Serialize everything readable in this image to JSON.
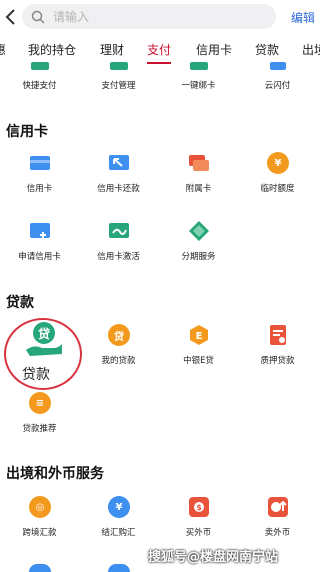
{
  "search": {
    "placeholder": "请输入",
    "edit_label": "编辑"
  },
  "tabs": [
    {
      "label": "惠",
      "active": false
    },
    {
      "label": "我的持仓",
      "active": false
    },
    {
      "label": "理财",
      "active": false
    },
    {
      "label": "支付",
      "active": true
    },
    {
      "label": "信用卡",
      "active": false
    },
    {
      "label": "贷款",
      "active": false
    },
    {
      "label": "出境",
      "active": false
    }
  ],
  "payment": {
    "items": [
      {
        "label": "快捷支付",
        "icon": "quick-pay-icon"
      },
      {
        "label": "支付管理",
        "icon": "pay-management-icon"
      },
      {
        "label": "一键绑卡",
        "icon": "bind-card-icon"
      },
      {
        "label": "云闪付",
        "icon": "cloud-quickpass-icon"
      }
    ]
  },
  "credit_card": {
    "title": "信用卡",
    "items": [
      {
        "label": "信用卡",
        "icon": "credit-card-icon"
      },
      {
        "label": "信用卡还款",
        "icon": "credit-card-repay-icon"
      },
      {
        "label": "附属卡",
        "icon": "supplementary-card-icon"
      },
      {
        "label": "临时额度",
        "icon": "temporary-limit-icon"
      },
      {
        "label": "申请信用卡",
        "icon": "apply-credit-card-icon"
      },
      {
        "label": "信用卡激活",
        "icon": "activate-card-icon"
      },
      {
        "label": "分期服务",
        "icon": "installment-icon"
      }
    ]
  },
  "loans": {
    "title": "贷款",
    "big_label": "贷款",
    "items": [
      {
        "label": "我的贷款",
        "icon": "my-loan-icon"
      },
      {
        "label": "中银E贷",
        "icon": "boc-e-loan-icon"
      },
      {
        "label": "质押贷款",
        "icon": "pledge-loan-icon"
      },
      {
        "label": "贷款推荐",
        "icon": "loan-recommend-icon"
      }
    ],
    "glyph": "贷",
    "e_glyph": "E"
  },
  "fx": {
    "title": "出境和外币服务",
    "items": [
      {
        "label": "跨境汇款",
        "icon": "cross-border-remit-icon"
      },
      {
        "label": "结汇购汇",
        "icon": "fx-settlement-icon"
      },
      {
        "label": "买外币",
        "icon": "buy-fx-icon"
      },
      {
        "label": "卖外币",
        "icon": "sell-fx-icon"
      }
    ]
  },
  "watermark": "搜狐号@楼盘网南宁站",
  "colors": {
    "accent": "#c8102e",
    "link": "#2c6ad6",
    "green": "#27a67a",
    "orange": "#f39a1e",
    "red": "#e8533a",
    "blue": "#3d8ff0"
  }
}
